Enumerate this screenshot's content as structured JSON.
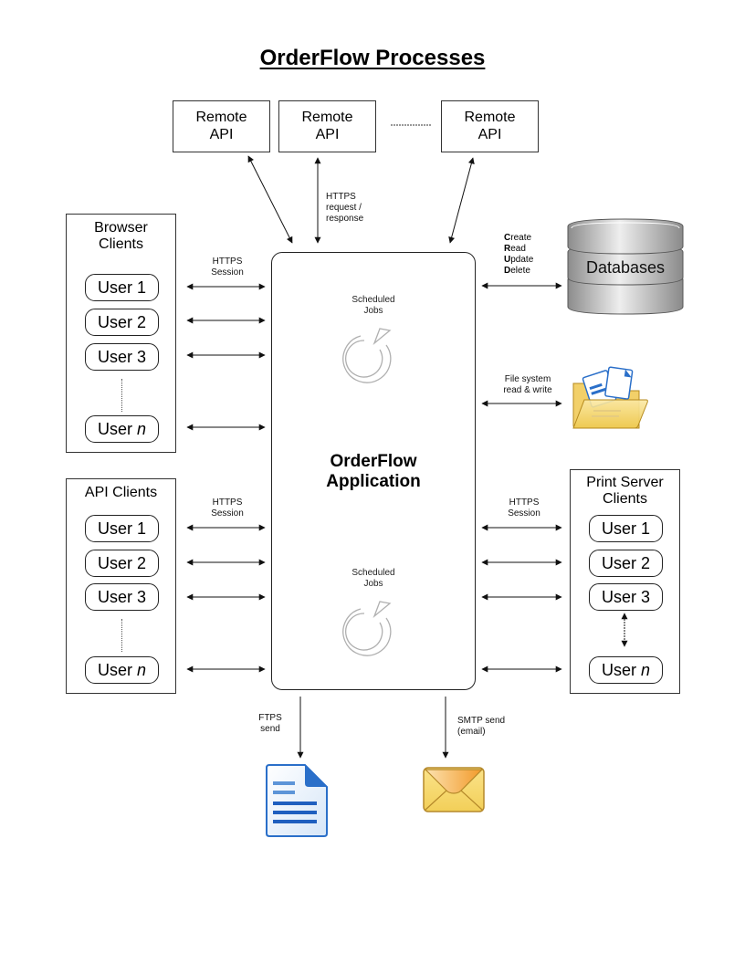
{
  "title": "OrderFlow Processes",
  "remote_apis": [
    {
      "line1": "Remote",
      "line2": "API"
    },
    {
      "line1": "Remote",
      "line2": "API"
    },
    {
      "line1": "Remote",
      "line2": "API"
    }
  ],
  "remote_link_label": {
    "line1": "HTTPS",
    "line2": "request /",
    "line3": "response"
  },
  "application": {
    "title_line1": "OrderFlow",
    "title_line2": "Application",
    "scheduled_jobs": [
      {
        "line1": "Scheduled",
        "line2": "Jobs",
        "icon": "refresh-icon"
      },
      {
        "line1": "Scheduled",
        "line2": "Jobs",
        "icon": "refresh-icon"
      }
    ]
  },
  "browser_clients": {
    "title_line1": "Browser",
    "title_line2": "Clients",
    "link_label": {
      "line1": "HTTPS",
      "line2": "Session"
    },
    "users": [
      "User 1",
      "User 2",
      "User 3"
    ],
    "last_user_prefix": "User",
    "last_user_var": "n"
  },
  "api_clients": {
    "title": "API Clients",
    "link_label": {
      "line1": "HTTPS",
      "line2": "Session"
    },
    "users": [
      "User 1",
      "User 2",
      "User 3"
    ],
    "last_user_prefix": "User",
    "last_user_var": "n"
  },
  "print_server_clients": {
    "title_line1": "Print Server",
    "title_line2": "Clients",
    "link_label": {
      "line1": "HTTPS",
      "line2": "Session"
    },
    "users": [
      "User 1",
      "User 2",
      "User 3"
    ],
    "last_user_prefix": "User",
    "last_user_var": "n"
  },
  "databases": {
    "label": "Databases",
    "icon": "database-icon",
    "crud": [
      {
        "initial": "C",
        "rest": "reate"
      },
      {
        "initial": "R",
        "rest": "ead"
      },
      {
        "initial": "U",
        "rest": "pdate"
      },
      {
        "initial": "D",
        "rest": "elete"
      }
    ]
  },
  "file_system": {
    "icon": "folder-icon",
    "label_line1": "File system",
    "label_line2": "read & write"
  },
  "ftps": {
    "icon": "document-icon",
    "label_line1": "FTPS",
    "label_line2": "send"
  },
  "smtp": {
    "icon": "envelope-icon",
    "label_line1": "SMTP send",
    "label_line2": "(email)"
  },
  "colors": {
    "stroke": "#222222",
    "jobs_icon": "#b0b0b0",
    "db_gray": "#a8a8a8",
    "folder_yellow": "#f5d97a",
    "doc_blue": "#2a6fc9",
    "envelope_orange": "#f2a93b"
  }
}
